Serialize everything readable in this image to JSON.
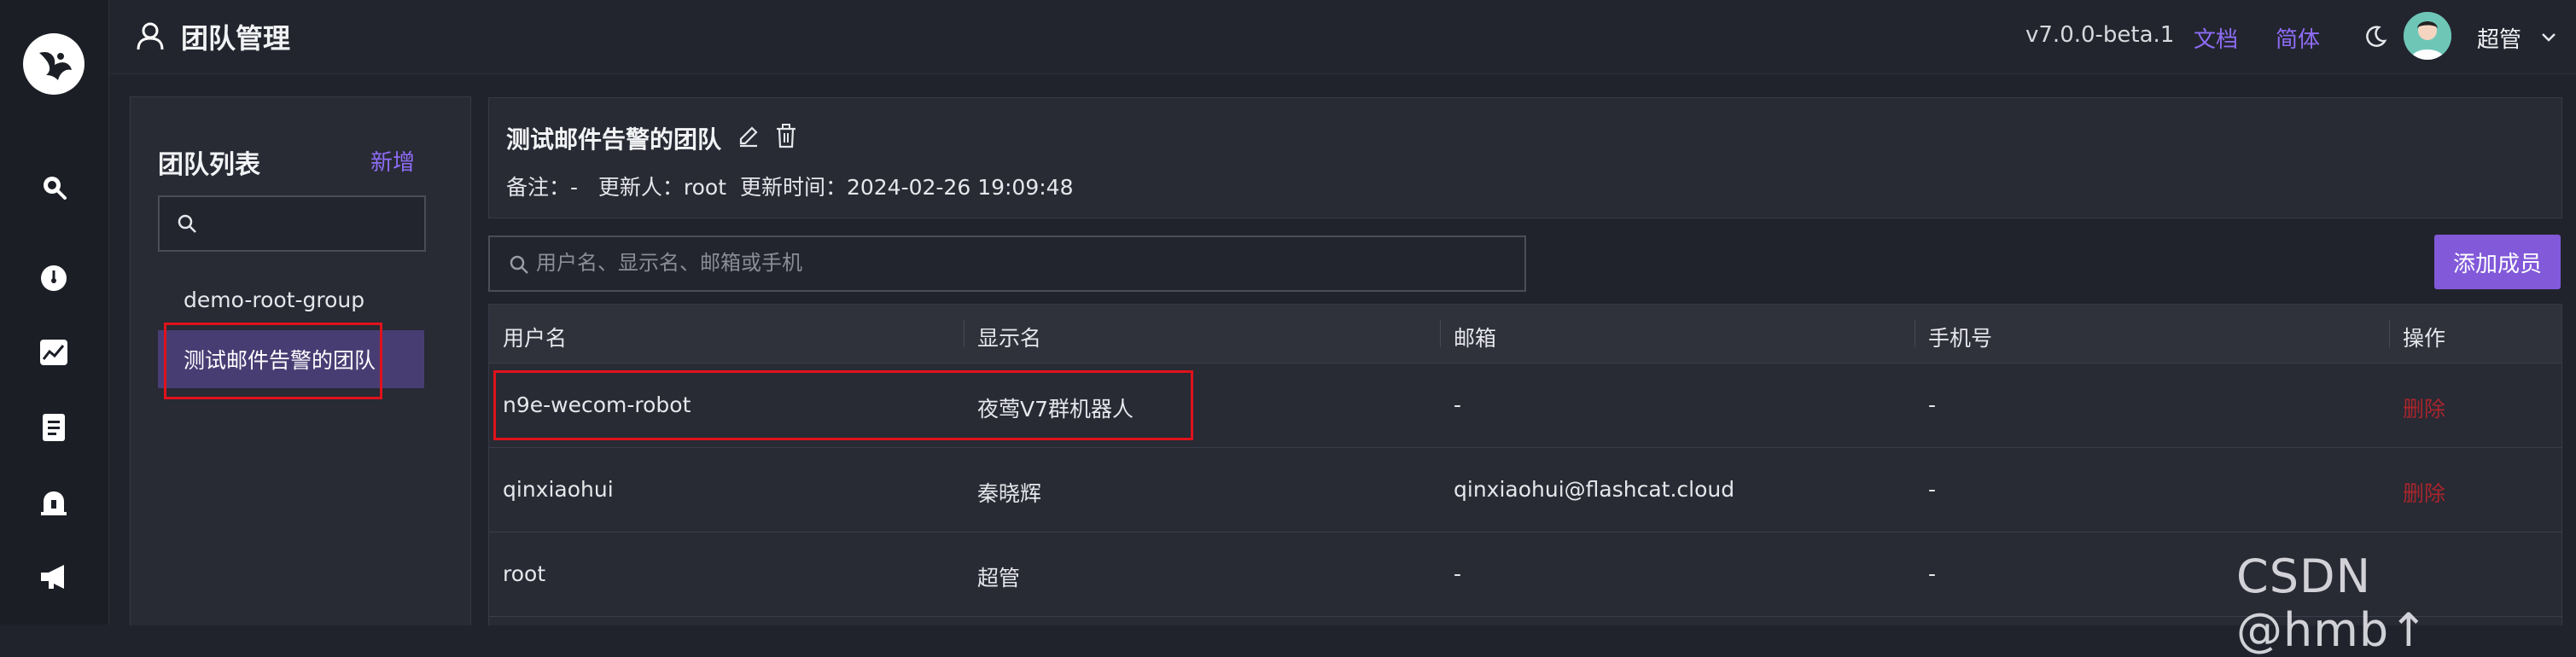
{
  "header": {
    "title": "团队管理",
    "version": "v7.0.0-beta.1",
    "docs_link": "文档",
    "language": "简体",
    "user_name": "超管"
  },
  "sidebar_nav": [
    {
      "icon": "search-icon"
    },
    {
      "icon": "dashboard-gauge-icon"
    },
    {
      "icon": "metrics-chart-icon"
    },
    {
      "icon": "document-icon"
    },
    {
      "icon": "alarm-bell-icon"
    },
    {
      "icon": "megaphone-icon"
    }
  ],
  "team_list": {
    "title": "团队列表",
    "add_label": "新增",
    "search_placeholder": "",
    "groups": [
      {
        "name": "demo-root-group",
        "active": false
      },
      {
        "name": "测试邮件告警的团队",
        "active": true
      }
    ]
  },
  "team_detail": {
    "name": "测试邮件告警的团队",
    "note_label": "备注：",
    "note_value": "-",
    "updater_label": "更新人：",
    "updater_value": "root",
    "update_time_label": "更新时间：",
    "update_time_value": "2024-02-26 19:09:48"
  },
  "member_search": {
    "placeholder": "用户名、显示名、邮箱或手机"
  },
  "add_member_label": "添加成员",
  "table": {
    "columns": [
      "用户名",
      "显示名",
      "邮箱",
      "手机号",
      "操作"
    ],
    "rows": [
      {
        "username": "n9e-wecom-robot",
        "display_name": "夜莺V7群机器人",
        "email": "-",
        "phone": "-",
        "action": "删除"
      },
      {
        "username": "qinxiaohui",
        "display_name": "秦晓辉",
        "email": "qinxiaohui@flashcat.cloud",
        "phone": "-",
        "action": "删除"
      },
      {
        "username": "root",
        "display_name": "超管",
        "email": "-",
        "phone": "-",
        "action": ""
      }
    ]
  },
  "watermark": "CSDN @hmb↑",
  "colors": {
    "accent": "#8159d9",
    "link": "#8e6cf6",
    "danger": "#a8262c",
    "highlight_box": "#e0121b",
    "active_group_bg": "#483d73"
  }
}
